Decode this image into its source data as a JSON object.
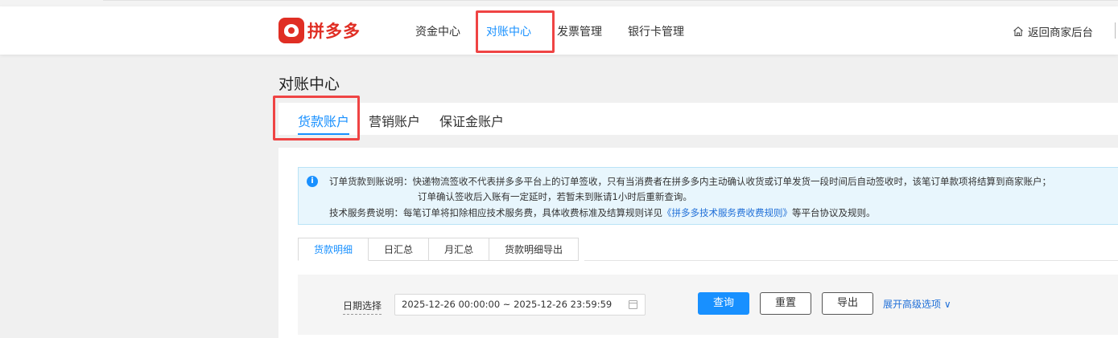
{
  "header": {
    "logo_text": "拼多多",
    "nav": [
      "资金中心",
      "对账中心",
      "发票管理",
      "银行卡管理"
    ],
    "back_label": "返回商家后台"
  },
  "page": {
    "title": "对账中心"
  },
  "account_tabs": [
    "货款账户",
    "营销账户",
    "保证金账户"
  ],
  "notice": {
    "line1": "订单货款到账说明：快递物流签收不代表拼多多平台上的订单签收，只有当消费者在拼多多内主动确认收货或订单发货一段时间后自动签收时，该笔订单款项将结算到商家账户；",
    "line2": "订单确认签收后入账有一定延时，若暂未到账请1小时后重新查询。",
    "line3_prefix": "技术服务费说明：每笔订单将扣除相应技术服务费，具体收费标准及结算规则详见",
    "line3_link": "《拼多多技术服务费收费规则》",
    "line3_suffix": "等平台协议及规则。"
  },
  "sub_tabs": [
    "货款明细",
    "日汇总",
    "月汇总",
    "货款明细导出"
  ],
  "filter": {
    "date_label": "日期选择",
    "date_value": "2025-12-26 00:00:00 ~ 2025-12-26 23:59:59",
    "query_label": "查询",
    "reset_label": "重置",
    "export_label": "导出",
    "advanced_label": "展开高级选项 ∨"
  },
  "colors": {
    "accent": "#1890ff",
    "brand": "#e02e24",
    "highlight_box": "#ef4444"
  }
}
